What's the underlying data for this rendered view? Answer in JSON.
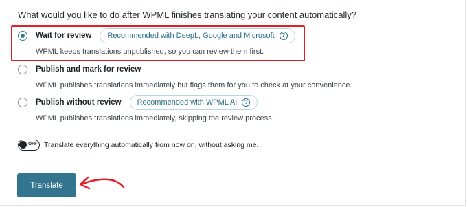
{
  "question": "What would you like to do after WPML finishes translating your content automatically?",
  "options": [
    {
      "label": "Wait for review",
      "badge": "Recommended with DeepL, Google and Microsoft",
      "badge_icon": "help-icon",
      "description": "WPML keeps translations unpublished, so you can review them first.",
      "selected": true
    },
    {
      "label": "Publish and mark for review",
      "description": "WPML publishes translations immediately but flags them for you to check at your convenience.",
      "selected": false
    },
    {
      "label": "Publish without review",
      "badge": "Recommended with WPML AI",
      "badge_icon": "help-icon",
      "description": "WPML publishes translations immediately, skipping the review process.",
      "selected": false
    }
  ],
  "toggle": {
    "state_text": "OFF",
    "label": "Translate everything automatically from now on, without asking me.",
    "on": false
  },
  "translate_button": "Translate",
  "colors": {
    "accent": "#33758f",
    "highlight_border": "#e11f2a",
    "annotation_arrow": "#e11f2a"
  }
}
